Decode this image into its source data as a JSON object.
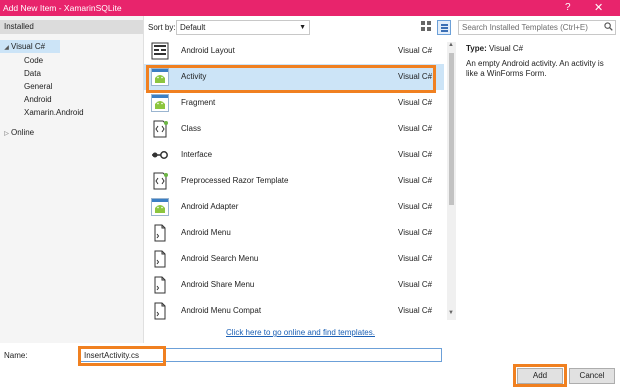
{
  "window": {
    "title": "Add New Item - XamarinSQLite",
    "help": "?",
    "close": "✕"
  },
  "sidebar": {
    "installed": "Installed",
    "tree": [
      {
        "label": "Visual C#",
        "expanded": true,
        "selected": true,
        "indent": 0
      },
      {
        "label": "Code",
        "indent": 1
      },
      {
        "label": "Data",
        "indent": 1
      },
      {
        "label": "General",
        "indent": 1
      },
      {
        "label": "Android",
        "indent": 1
      },
      {
        "label": "Xamarin.Android",
        "indent": 1
      },
      {
        "label": "Online",
        "expanded": false,
        "indent": 0
      }
    ]
  },
  "toolbar": {
    "sort_label": "Sort by:",
    "sort_value": "Default"
  },
  "templates": [
    {
      "name": "Android Layout",
      "lang": "Visual C#",
      "icon": "layout-icon"
    },
    {
      "name": "Activity",
      "lang": "Visual C#",
      "icon": "android-icon",
      "selected": true
    },
    {
      "name": "Fragment",
      "lang": "Visual C#",
      "icon": "android-icon"
    },
    {
      "name": "Class",
      "lang": "Visual C#",
      "icon": "class-icon"
    },
    {
      "name": "Interface",
      "lang": "Visual C#",
      "icon": "interface-icon"
    },
    {
      "name": "Preprocessed Razor Template",
      "lang": "Visual C#",
      "icon": "class-icon"
    },
    {
      "name": "Android Adapter",
      "lang": "Visual C#",
      "icon": "android-icon"
    },
    {
      "name": "Android Menu",
      "lang": "Visual C#",
      "icon": "file-icon"
    },
    {
      "name": "Android Search Menu",
      "lang": "Visual C#",
      "icon": "file-icon"
    },
    {
      "name": "Android Share Menu",
      "lang": "Visual C#",
      "icon": "file-icon"
    },
    {
      "name": "Android Menu Compat",
      "lang": "Visual C#",
      "icon": "file-icon"
    }
  ],
  "online_link": "Click here to go online and find templates.",
  "details": {
    "search_placeholder": "Search Installed Templates (Ctrl+E)",
    "type_label": "Type:",
    "type_value": "Visual C#",
    "description": "An empty Android activity.  An activity is like a WinForms Form."
  },
  "footer": {
    "name_label": "Name:",
    "name_value": "InsertActivity.cs",
    "add": "Add",
    "cancel": "Cancel"
  },
  "colors": {
    "title_bar": "#e8246c",
    "highlight": "#f08020",
    "selection": "#cce4f7",
    "link": "#1a5fb4"
  }
}
